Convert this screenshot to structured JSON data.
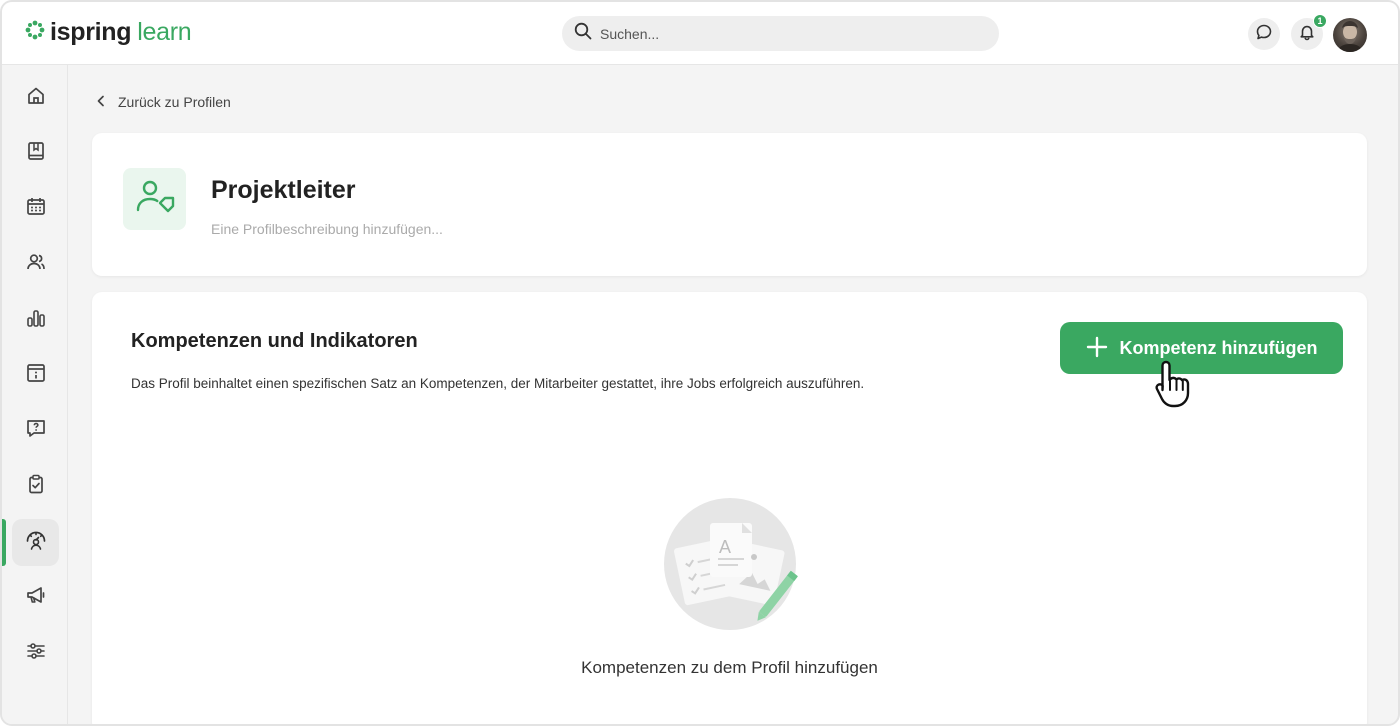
{
  "app": {
    "logo_bold": "ispring",
    "logo_light": "learn"
  },
  "header": {
    "search_placeholder": "Suchen...",
    "notification_count": "1",
    "icons": [
      "search-icon",
      "chat-icon",
      "bell-icon",
      "avatar"
    ]
  },
  "sidebar": {
    "items": [
      {
        "name": "home-icon",
        "active": false
      },
      {
        "name": "book-icon",
        "active": false
      },
      {
        "name": "calendar-icon",
        "active": false
      },
      {
        "name": "users-icon",
        "active": false
      },
      {
        "name": "chart-icon",
        "active": false
      },
      {
        "name": "info-card-icon",
        "active": false
      },
      {
        "name": "question-icon",
        "active": false
      },
      {
        "name": "clipboard-check-icon",
        "active": false
      },
      {
        "name": "gauge-person-icon",
        "active": true
      },
      {
        "name": "megaphone-icon",
        "active": false
      },
      {
        "name": "sliders-icon",
        "active": false
      }
    ]
  },
  "main": {
    "back_label": "Zurück zu Profilen",
    "profile": {
      "title": "Projektleiter",
      "description_placeholder": "Eine Profilbeschreibung hinzufügen..."
    },
    "competencies": {
      "title": "Kompetenzen und Indikatoren",
      "description": "Das Profil beinhaltet einen spezifischen Satz an Kompetenzen, der Mitarbeiter gestattet, ihre Jobs erfolgreich auszuführen.",
      "add_button_label": "Kompetenz hinzufügen",
      "empty_state_text": "Kompetenzen zu dem Profil hinzufügen"
    }
  },
  "colors": {
    "accent": "#3aa861",
    "accent_light": "#eaf6ee",
    "background": "#f4f4f4"
  }
}
